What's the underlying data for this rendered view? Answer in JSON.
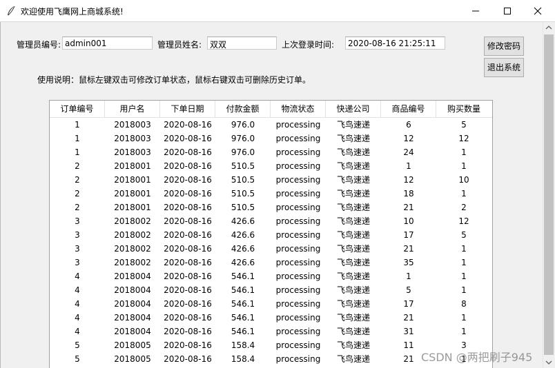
{
  "window": {
    "title": "欢迎使用飞鹰网上商城系统!"
  },
  "icons": {
    "app": "feather-icon",
    "minimize": "minimize-icon",
    "maximize": "maximize-icon",
    "close": "close-icon"
  },
  "admin": {
    "id_label": "管理员编号:",
    "id_value": "admin001",
    "name_label": "管理员姓名:",
    "name_value": "双双",
    "last_login_label": "上次登录时间:",
    "last_login_value": "2020-08-16 21:25:11"
  },
  "buttons": {
    "change_password": "修改密码",
    "logout": "退出系统"
  },
  "instructions": "使用说明：鼠标左键双击可修改订单状态，鼠标右键双击可删除历史订单。",
  "table": {
    "columns": [
      "订单编号",
      "用户名",
      "下单日期",
      "付款金额",
      "物流状态",
      "快递公司",
      "商品编号",
      "购买数量"
    ],
    "rows": [
      [
        "1",
        "2018003",
        "2020-08-16",
        "976.0",
        "processing",
        "飞鸟速递",
        "6",
        "5"
      ],
      [
        "1",
        "2018003",
        "2020-08-16",
        "976.0",
        "processing",
        "飞鸟速递",
        "12",
        "12"
      ],
      [
        "1",
        "2018003",
        "2020-08-16",
        "976.0",
        "processing",
        "飞鸟速递",
        "24",
        "1"
      ],
      [
        "2",
        "2018001",
        "2020-08-16",
        "510.5",
        "processing",
        "飞鸟速递",
        "1",
        "1"
      ],
      [
        "2",
        "2018001",
        "2020-08-16",
        "510.5",
        "processing",
        "飞鸟速递",
        "12",
        "10"
      ],
      [
        "2",
        "2018001",
        "2020-08-16",
        "510.5",
        "processing",
        "飞鸟速递",
        "18",
        "1"
      ],
      [
        "2",
        "2018001",
        "2020-08-16",
        "510.5",
        "processing",
        "飞鸟速递",
        "21",
        "2"
      ],
      [
        "3",
        "2018002",
        "2020-08-16",
        "426.6",
        "processing",
        "飞鸟速递",
        "10",
        "12"
      ],
      [
        "3",
        "2018002",
        "2020-08-16",
        "426.6",
        "processing",
        "飞鸟速递",
        "17",
        "5"
      ],
      [
        "3",
        "2018002",
        "2020-08-16",
        "426.6",
        "processing",
        "飞鸟速递",
        "21",
        "1"
      ],
      [
        "3",
        "2018002",
        "2020-08-16",
        "426.6",
        "processing",
        "飞鸟速递",
        "35",
        "1"
      ],
      [
        "4",
        "2018004",
        "2020-08-16",
        "546.1",
        "processing",
        "飞鸟速递",
        "1",
        "1"
      ],
      [
        "4",
        "2018004",
        "2020-08-16",
        "546.1",
        "processing",
        "飞鸟速递",
        "5",
        "1"
      ],
      [
        "4",
        "2018004",
        "2020-08-16",
        "546.1",
        "processing",
        "飞鸟速递",
        "17",
        "8"
      ],
      [
        "4",
        "2018004",
        "2020-08-16",
        "546.1",
        "processing",
        "飞鸟速递",
        "21",
        "1"
      ],
      [
        "4",
        "2018004",
        "2020-08-16",
        "546.1",
        "processing",
        "飞鸟速递",
        "31",
        "1"
      ],
      [
        "5",
        "2018005",
        "2020-08-16",
        "158.4",
        "processing",
        "飞鸟速递",
        "11",
        "3"
      ],
      [
        "5",
        "2018005",
        "2020-08-16",
        "158.4",
        "processing",
        "飞鸟速递",
        "21",
        "1"
      ]
    ]
  },
  "watermark": "CSDN @两把刷子945"
}
